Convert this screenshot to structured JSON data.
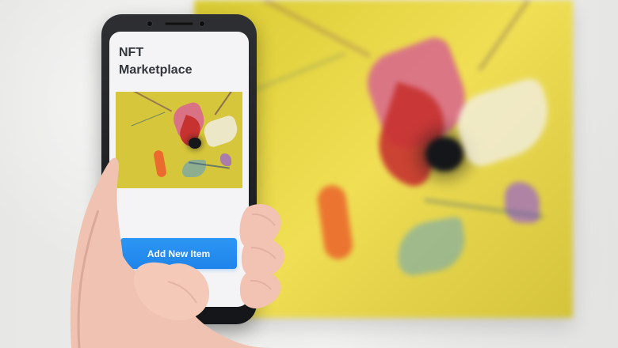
{
  "screen": {
    "title": "NFT\nMarketplace",
    "button_label": "Add New Item"
  }
}
